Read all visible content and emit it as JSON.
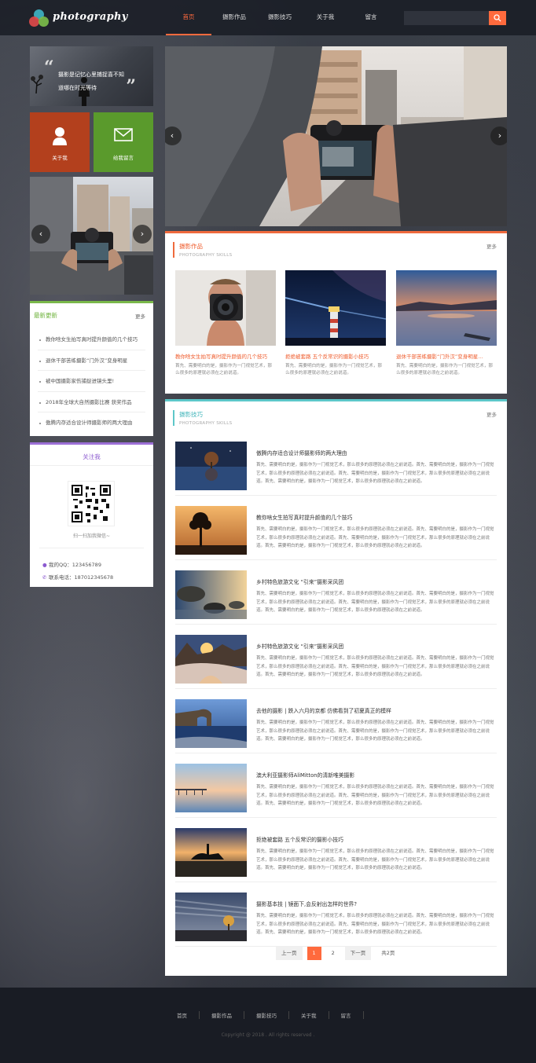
{
  "header": {
    "logo_text": "photography",
    "nav": [
      "首页",
      "摄影作品",
      "摄影技巧",
      "关于我",
      "留言"
    ],
    "active_index": 0,
    "search_placeholder": ""
  },
  "sidebar": {
    "quote": "摄影是记忆心里捕捉喜不知道哪在时光等待",
    "quote_line1": "摄影是记忆心里捕捉喜不知",
    "quote_line2": "道哪在时光等待",
    "tile_about": "关于我",
    "tile_message": "给我留言",
    "latest": {
      "title": "最新更新",
      "more": "更多",
      "items": [
        "教你啥女生拍写真时提升颜值的几个技巧",
        "退休干部苦练摄影“门外汉”变身明星",
        "被中国摄影家伤捕捉进镜头里!",
        "2018年全球大自然摄影比赛 获奖作品",
        "傲腾内存适合设计师摄影师的两大理由"
      ]
    },
    "follow": {
      "title": "关注我",
      "qr_caption": "扫一扫加我微信~",
      "qq": "我的QQ：123456789",
      "phone": "联系电话：187012345678"
    }
  },
  "works": {
    "title": "摄影作品",
    "subtitle": "PHOTOGRAPHY SKILLS",
    "more": "更多",
    "cards": [
      {
        "title": "教你啥女生拍写真时提升颜值的几个技巧",
        "desc": "首先、需要明白的是，摄影作为一门视觉艺术，那么很多的原理就必须在之前说道。"
      },
      {
        "title": "拒绝被套路 五个反常识的摄影小技巧",
        "desc": "首先、需要明白的是，摄影作为一门视觉艺术，那么很多的原理就必须在之前说道。"
      },
      {
        "title": "退休干部苦练摄影“门外汉”变身明星...",
        "desc": "首先、需要明白的是，摄影作为一门视觉艺术，那么很多的原理就必须在之前说道。"
      }
    ]
  },
  "skills": {
    "title": "摄影技巧",
    "subtitle": "PHOTOGRAPHY SKILLS",
    "more": "更多",
    "desc": "首先、需要明白的是，摄影作为一门视觉艺术，那么很多的原理就必须在之前说道。首先、需要明白的是，摄影作为一门视觉艺术，那么很多的原理就必须在之前说道。首先、需要明白的是，摄影作为一门视觉艺术，那么很多的原理就必须在之前说道。首先、需要明白的是，摄影作为一门视觉艺术，那么很多的原理就必须在之前说道。",
    "articles": [
      "傲腾内存适合设计师摄影师的两大理由",
      "教你啥女生拍写真时提升颜值的几个技巧",
      "乡村特色旅游文化 “引来”摄影采风团",
      "乡村特色旅游文化 “引来”摄影采风团",
      "去他的摄影 | 跌入六月的京都 仿佛看到了初夏真正的模样",
      "澳大利亚摄影师AliMitton的清新唯美摄影",
      "拒绝被套路 五个反常识的摄影小技巧",
      "摄影基本技 | 镜面下,会反射出怎样的世界?"
    ]
  },
  "pager": {
    "prev": "上一页",
    "pages": [
      "1",
      "2"
    ],
    "current": "1",
    "next": "下一页",
    "total": "共2页"
  },
  "footer": {
    "nav": [
      "首页",
      "摄影作品",
      "摄影技巧",
      "关于我",
      "留言"
    ],
    "copyright": "Copyright @ 2018 . All rights reserved ."
  },
  "colors": {
    "accent": "#ff6a3d",
    "about_tile": "#b3401d",
    "message_tile": "#5a9a2c",
    "latest_accent": "#7ab84a",
    "follow_accent": "#9c6fd6",
    "skills_accent": "#5dc7c9"
  }
}
